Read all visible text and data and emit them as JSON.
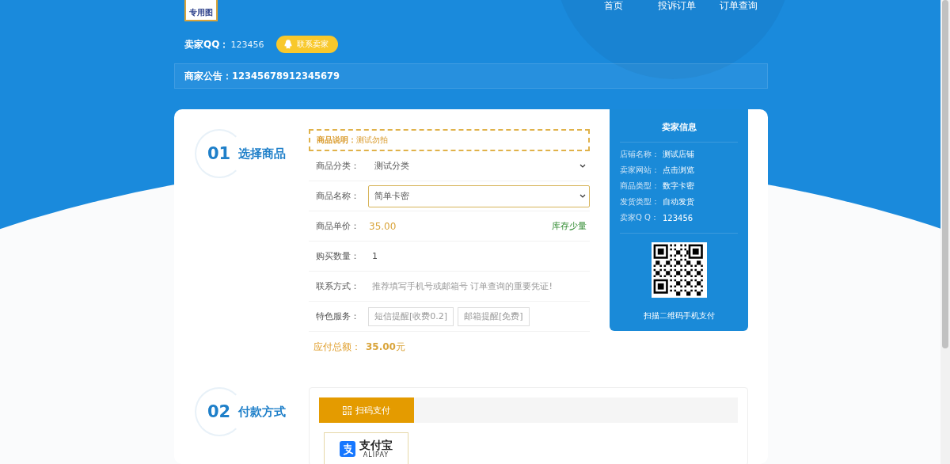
{
  "header": {
    "logo_text": "专用图",
    "nav": [
      {
        "label": "首页"
      },
      {
        "label": "投诉订单"
      },
      {
        "label": "订单查询"
      }
    ],
    "seller_qq_label": "卖家QQ：",
    "seller_qq": "123456",
    "contact_button": "联系卖家"
  },
  "notice": {
    "label": "商家公告：",
    "text": "12345678912345679"
  },
  "steps": [
    {
      "number": "01",
      "title": "选择商品"
    },
    {
      "number": "02",
      "title": "付款方式"
    }
  ],
  "product_desc": {
    "label": "商品说明：",
    "text": "测试勿拍"
  },
  "form": [
    {
      "kind": "select",
      "label": "商品分类：",
      "value": "测试分类",
      "focused": false
    },
    {
      "kind": "select",
      "label": "商品名称：",
      "value": "简单卡密",
      "focused": true
    },
    {
      "kind": "price",
      "label": "商品单价：",
      "value": "35.00",
      "stock": "库存少量"
    },
    {
      "kind": "input",
      "label": "购买数量：",
      "value": "1"
    },
    {
      "kind": "input",
      "label": "联系方式：",
      "placeholder": "推荐填写手机号或邮箱号 订单查询的重要凭证!"
    },
    {
      "kind": "services",
      "label": "特色服务：",
      "options": [
        {
          "label": "短信提醒[收费0.2]",
          "selected": false
        },
        {
          "label": "邮箱提醒[免费]",
          "selected": false
        }
      ]
    }
  ],
  "total": {
    "label": "应付总额：",
    "value": "35.00",
    "unit": "元"
  },
  "seller_panel": {
    "title": "卖家信息",
    "rows": [
      {
        "label": "店铺名称：",
        "value": "测试店铺"
      },
      {
        "label": "卖家网站：",
        "value": "点击浏览"
      },
      {
        "label": "商品类型：",
        "value": "数字卡密"
      },
      {
        "label": "发货类型：",
        "value": "自动发货"
      },
      {
        "label": "卖家Q Q：",
        "value": "123456"
      }
    ],
    "qr_caption": "扫描二维码手机支付"
  },
  "payment": {
    "tabs": [
      {
        "label": "扫码支付",
        "selected": true
      }
    ],
    "methods": [
      {
        "name": "支付宝",
        "sub": "ALIPAY",
        "selected": false
      }
    ]
  }
}
